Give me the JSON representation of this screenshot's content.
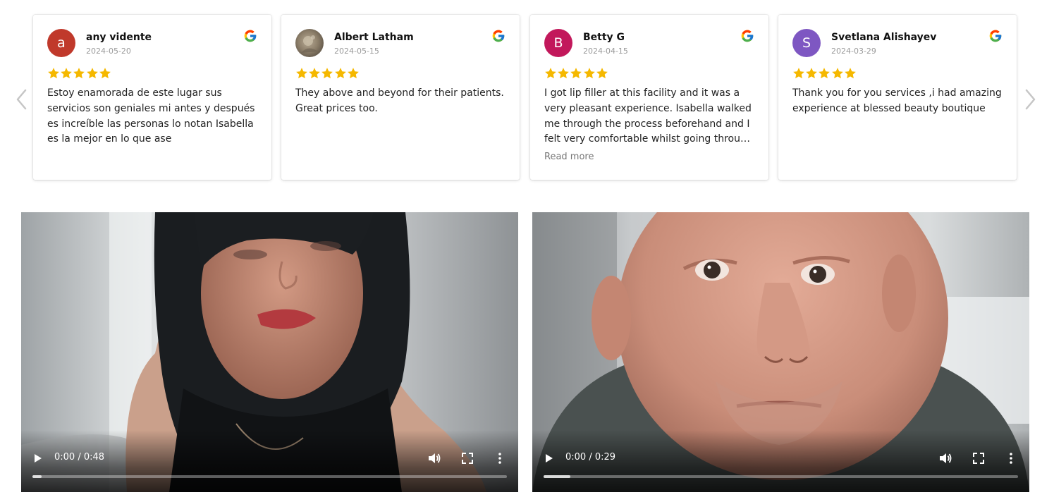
{
  "reviews": [
    {
      "name": "any vidente",
      "date": "2024-05-20",
      "avatar_letter": "a",
      "avatar_color": "#c0392b",
      "rating": 5,
      "text": "Estoy enamorada de este lugar sus servicios son geniales mi antes y después es increíble las personas lo notan Isabella es la mejor en lo que ase",
      "read_more": ""
    },
    {
      "name": "Albert Latham",
      "date": "2024-05-15",
      "avatar_letter": "",
      "avatar_color": "",
      "rating": 5,
      "text": "They above and beyond for their patients. Great prices too.",
      "read_more": ""
    },
    {
      "name": "Betty G",
      "date": "2024-04-15",
      "avatar_letter": "B",
      "avatar_color": "#c2185b",
      "rating": 5,
      "text": "I got lip filler at this facility and it was a very pleasant experience. Isabella walked me through the process beforehand and I felt very comfortable whilst going through it. The results are amazing.",
      "read_more": "Read more"
    },
    {
      "name": "Svetlana Alishayev",
      "date": "2024-03-29",
      "avatar_letter": "S",
      "avatar_color": "#7e57c2",
      "rating": 5,
      "text": "Thank you for you services ,i had amazing experience at blessed beauty boutique",
      "read_more": ""
    }
  ],
  "icons": {
    "prev": "chevron-left-icon",
    "next": "chevron-right-icon",
    "source": "google-g-icon",
    "star": "star-icon",
    "play": "play-icon",
    "volume": "volume-icon",
    "fullscreen": "fullscreen-icon",
    "more": "more-vertical-icon"
  },
  "colors": {
    "star": "#f5b800",
    "nav_arrow": "#c6c6c6"
  },
  "videos": [
    {
      "time": "0:00 / 0:48",
      "buffered_fraction": 0.02
    },
    {
      "time": "0:00 / 0:29",
      "buffered_fraction": 0.057
    }
  ]
}
